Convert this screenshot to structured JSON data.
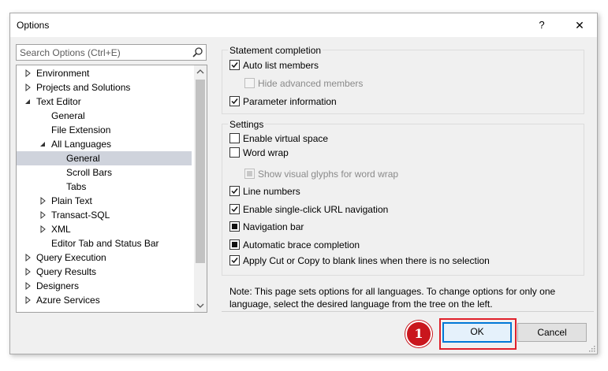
{
  "window": {
    "title": "Options",
    "help_glyph": "?",
    "close_glyph": "✕"
  },
  "search": {
    "placeholder": "Search Options (Ctrl+E)",
    "icon": "search-icon"
  },
  "tree": {
    "items": [
      {
        "label": "Environment",
        "arrow": "collapsed"
      },
      {
        "label": "Projects and Solutions",
        "arrow": "collapsed"
      },
      {
        "label": "Text Editor",
        "arrow": "expanded"
      },
      {
        "label": "General",
        "arrow": "none"
      },
      {
        "label": "File Extension",
        "arrow": "none"
      },
      {
        "label": "All Languages",
        "arrow": "expanded"
      },
      {
        "label": "General",
        "arrow": "none",
        "selected": true
      },
      {
        "label": "Scroll Bars",
        "arrow": "none"
      },
      {
        "label": "Tabs",
        "arrow": "none"
      },
      {
        "label": "Plain Text",
        "arrow": "collapsed"
      },
      {
        "label": "Transact-SQL",
        "arrow": "collapsed"
      },
      {
        "label": "XML",
        "arrow": "collapsed"
      },
      {
        "label": "Editor Tab and Status Bar",
        "arrow": "none"
      },
      {
        "label": "Query Execution",
        "arrow": "collapsed"
      },
      {
        "label": "Query Results",
        "arrow": "collapsed"
      },
      {
        "label": "Designers",
        "arrow": "collapsed"
      },
      {
        "label": "Azure Services",
        "arrow": "collapsed"
      }
    ]
  },
  "statement_completion": {
    "title": "Statement completion",
    "options": [
      {
        "label": "Auto list members",
        "state": "checked",
        "enabled": true
      },
      {
        "label": "Hide advanced members",
        "state": "unchecked",
        "enabled": false
      },
      {
        "label": "Parameter information",
        "state": "checked",
        "enabled": true
      }
    ]
  },
  "settings": {
    "title": "Settings",
    "options": [
      {
        "label": "Enable virtual space",
        "state": "unchecked",
        "enabled": true
      },
      {
        "label": "Word wrap",
        "state": "unchecked",
        "enabled": true
      },
      {
        "label": "Show visual glyphs for word wrap",
        "state": "indeterminate",
        "enabled": false
      },
      {
        "label": "Line numbers",
        "state": "checked",
        "enabled": true
      },
      {
        "label": "Enable single-click URL navigation",
        "state": "checked",
        "enabled": true
      },
      {
        "label": "Navigation bar",
        "state": "indeterminate",
        "enabled": true
      },
      {
        "label": "Automatic brace completion",
        "state": "indeterminate",
        "enabled": true
      },
      {
        "label": "Apply Cut or Copy to blank lines when there is no selection",
        "state": "checked",
        "enabled": true
      }
    ]
  },
  "note": {
    "line1": "Note: This page sets options for all languages. To change options for only one",
    "line2": "language, select the desired language from the tree on the left."
  },
  "buttons": {
    "ok": "OK",
    "cancel": "Cancel"
  },
  "annotation": {
    "step": "1",
    "color": "#e0202a"
  },
  "colors": {
    "accent": "#0078d7",
    "selection": "#cfd3dc",
    "dialog_bg": "#f0f0f0"
  }
}
